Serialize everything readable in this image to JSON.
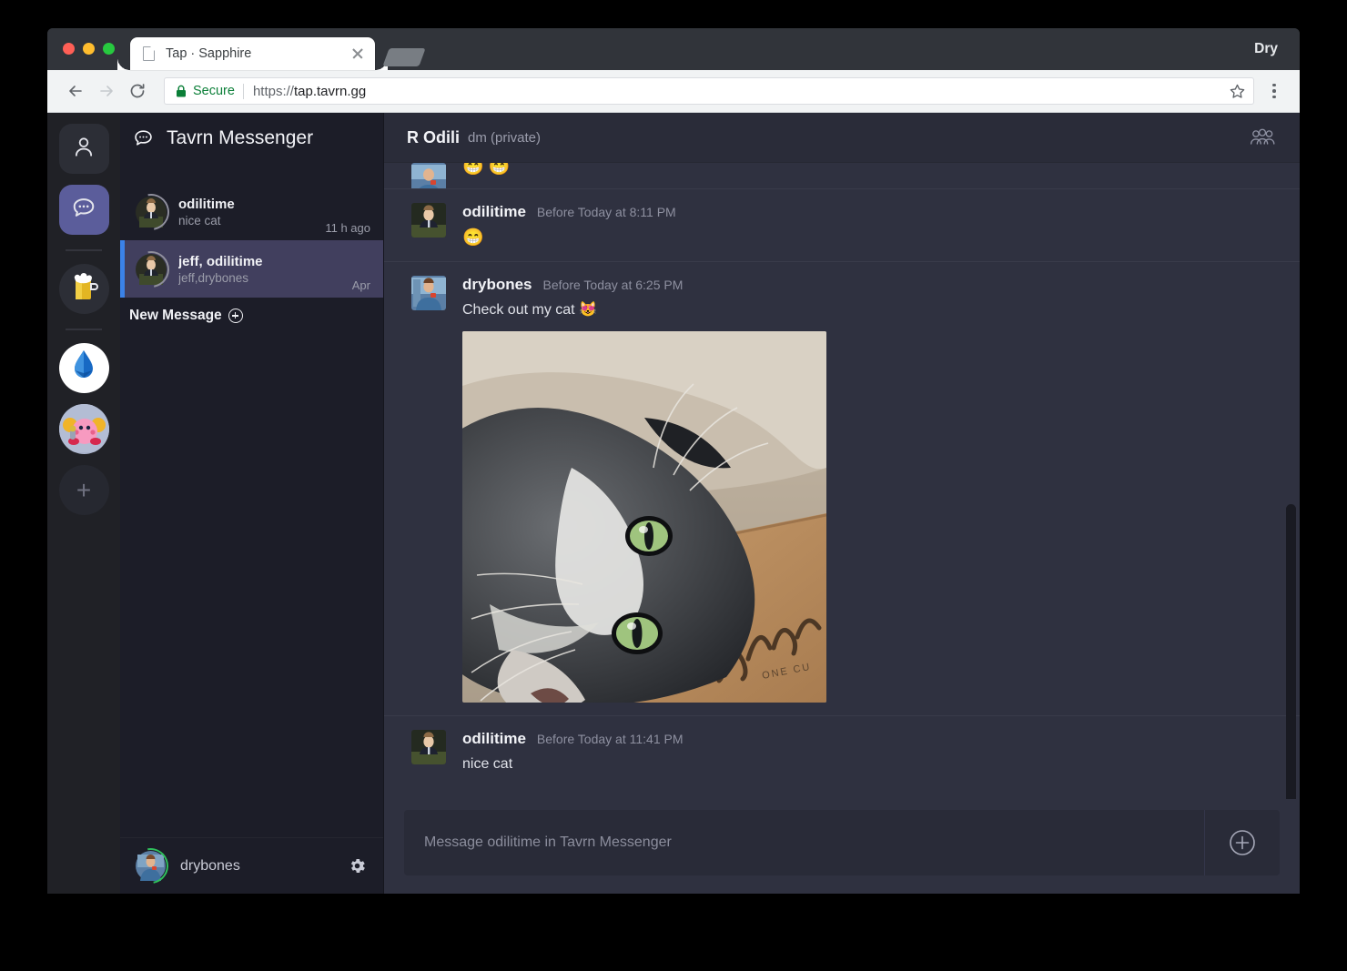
{
  "browser": {
    "tab_title": "Tap · Sapphire",
    "tab_favicon": "page-icon",
    "new_tab": "new-tab-button",
    "profile_name": "Dry",
    "back": "back-arrow-icon",
    "forward": "forward-arrow-icon",
    "reload": "reload-icon",
    "secure_label": "Secure",
    "lock": "lock-icon",
    "url_scheme": "https://",
    "url_host": "tap.tavrn.gg",
    "bookmark": "star-icon",
    "menu": "three-dot-menu-icon"
  },
  "rail": {
    "items": [
      {
        "name": "profile",
        "icon": "person-icon",
        "active": false
      },
      {
        "name": "messenger",
        "icon": "chat-bubble-icon",
        "active": true
      },
      {
        "name": "tavrn-server",
        "icon": "beer-mug-icon",
        "active": false
      },
      {
        "name": "sapphire-server",
        "icon": "gem-icon",
        "active": false
      },
      {
        "name": "kirby-server",
        "icon": "kirby-avatar-icon",
        "active": false
      }
    ],
    "add_label": "+",
    "add_name": "add-server-button"
  },
  "sidebar": {
    "title": "Tavrn Messenger",
    "title_icon": "chat-bubble-icon",
    "conversations": [
      {
        "name": "odilitime",
        "preview": "nice cat",
        "time": "11 h ago",
        "selected": false
      },
      {
        "name": "jeff, odilitime",
        "preview": "jeff,drybones",
        "time": "Apr",
        "selected": true
      }
    ],
    "new_message_label": "New Message",
    "new_message_icon": "plus-circle-icon",
    "user": {
      "name": "drybones",
      "status": "online",
      "settings_icon": "gear-icon"
    }
  },
  "chat": {
    "title": "R Odili",
    "subtitle": "dm (private)",
    "members_icon": "people-group-icon",
    "messages": [
      {
        "author": "",
        "time": "",
        "text": "",
        "emoji": "😁 😁",
        "partial": true,
        "avatar": "drybones-avatar"
      },
      {
        "author": "odilitime",
        "time": "Before Today at 8:11 PM",
        "text": "",
        "emoji": "😁",
        "avatar": "odilitime-avatar"
      },
      {
        "author": "drybones",
        "time": "Before Today at 6:25 PM",
        "text": "Check out my cat 😻",
        "image": "cat-photo",
        "avatar": "drybones-avatar"
      },
      {
        "author": "odilitime",
        "time": "Before Today at 11:41 PM",
        "text": "nice cat",
        "avatar": "odilitime-avatar"
      }
    ],
    "composer": {
      "placeholder": "Message odilitime in Tavrn Messenger",
      "add_icon": "plus-circle-icon"
    }
  },
  "colors": {
    "accent_purple": "#5b5d9b",
    "selected_conv": "#413f5e",
    "selected_bar": "#3b82e8",
    "chat_bg": "#2f3140",
    "sidebar_bg": "#1c1d28",
    "rail_bg": "#202126",
    "secure_green": "#0b7f38",
    "online_green": "#2fbf5c"
  }
}
